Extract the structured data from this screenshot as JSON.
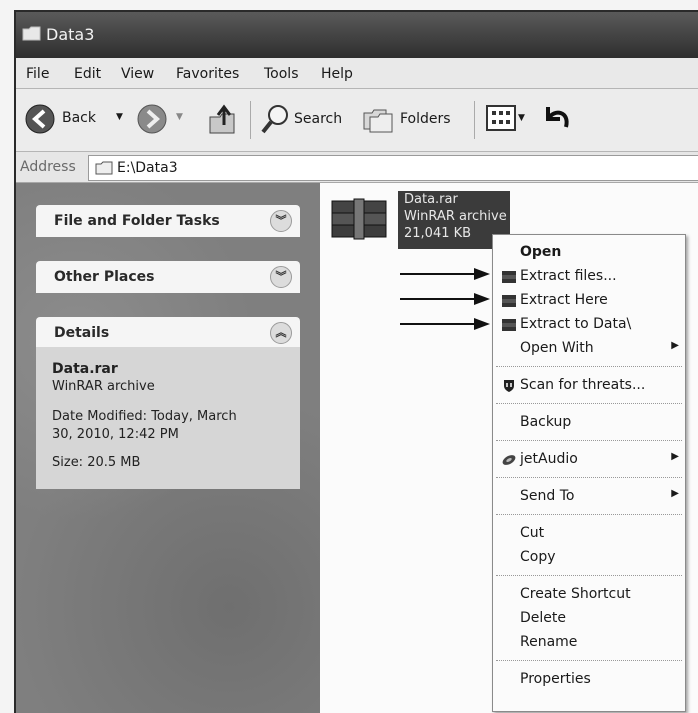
{
  "window": {
    "title": "Data3"
  },
  "menubar": {
    "items": [
      "File",
      "Edit",
      "View",
      "Favorites",
      "Tools",
      "Help"
    ]
  },
  "toolbar": {
    "back_label": "Back",
    "search_label": "Search",
    "folders_label": "Folders"
  },
  "address": {
    "label": "Address",
    "path": "E:\\Data3"
  },
  "tasks": {
    "file_folder_tasks": "File and Folder Tasks",
    "other_places": "Other Places",
    "details": "Details"
  },
  "details": {
    "name": "Data.rar",
    "type": "WinRAR archive",
    "modified_line1": "Date Modified: Today, March",
    "modified_line2": "30, 2010, 12:42 PM",
    "size": "Size: 20.5 MB"
  },
  "file": {
    "name": "Data.rar",
    "type": "WinRAR archive",
    "size": "21,041 KB"
  },
  "context_menu": {
    "open": "Open",
    "extract_files": "Extract files...",
    "extract_here": "Extract Here",
    "extract_to": "Extract to Data\\",
    "open_with": "Open With",
    "scan": "Scan for threats...",
    "backup": "Backup",
    "jetaudio": "jetAudio",
    "send_to": "Send To",
    "cut": "Cut",
    "copy": "Copy",
    "create_shortcut": "Create Shortcut",
    "delete": "Delete",
    "rename": "Rename",
    "properties": "Properties"
  }
}
